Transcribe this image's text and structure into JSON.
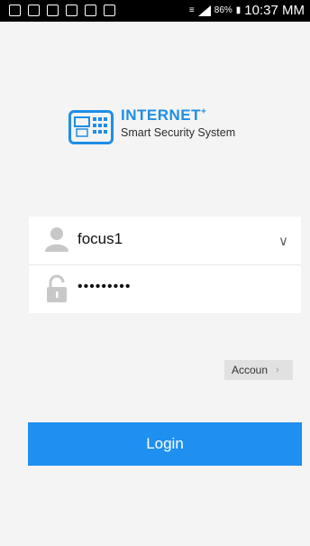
{
  "status_bar": {
    "battery": "86%",
    "time": "10:37 MM"
  },
  "logo": {
    "title": "INTERNET",
    "title_sup": "+",
    "subtitle": "Smart Security System"
  },
  "login_form": {
    "username": "focus1",
    "password_masked": "•••••••••",
    "dropdown_icon": "chevron-down-icon"
  },
  "account_button": {
    "label": "Accoun"
  },
  "login_button": {
    "label": "Login"
  },
  "colors": {
    "brand_blue": "#1f8ff0",
    "background": "#f4f4f4"
  }
}
